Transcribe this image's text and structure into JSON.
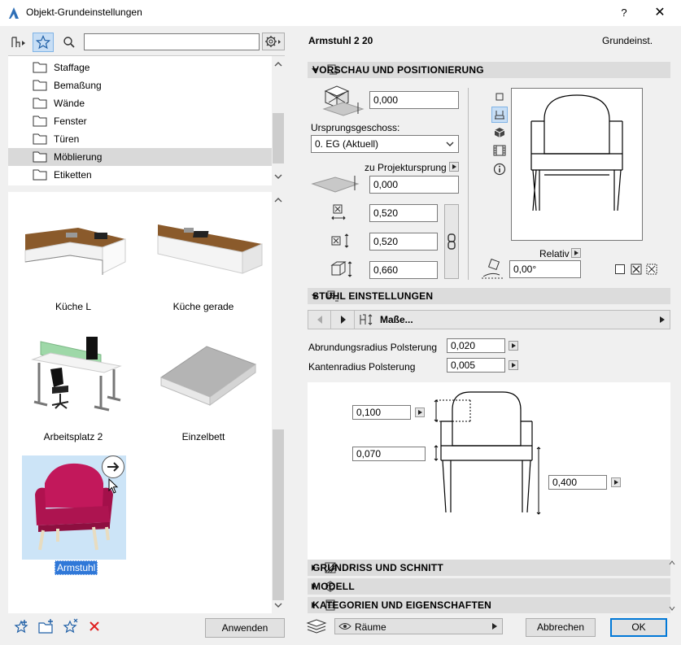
{
  "window": {
    "title": "Objekt-Grundeinstellungen",
    "help": "?",
    "close": "✕"
  },
  "library": {
    "search_placeholder": "",
    "folders": [
      {
        "label": "Staffage"
      },
      {
        "label": "Bemaßung"
      },
      {
        "label": "Wände"
      },
      {
        "label": "Fenster"
      },
      {
        "label": "Türen"
      },
      {
        "label": "Möblierung"
      },
      {
        "label": "Etiketten"
      }
    ],
    "thumbnails": [
      {
        "label": "Küche L"
      },
      {
        "label": "Küche gerade"
      },
      {
        "label": "Arbeitsplatz 2"
      },
      {
        "label": "Einzelbett"
      },
      {
        "label": "Armstuhl"
      }
    ],
    "apply_button": "Anwenden"
  },
  "object": {
    "name": "Armstuhl 2 20",
    "mode": "Grundeinst."
  },
  "preview_section": {
    "title": "VORSCHAU UND POSITIONIERUNG",
    "height_offset": "0,000",
    "ursprungsgeschoss_label": "Ursprungsgeschoss:",
    "ursprungsgeschoss_value": "0. EG (Aktuell)",
    "zu_projektursprung": "zu Projektursprung",
    "projekt_offset": "0,000",
    "width": "0,520",
    "depth": "0,520",
    "height": "0,660",
    "relativ": "Relativ",
    "angle": "0,00°"
  },
  "stuhl_section": {
    "title": "STUHL EINSTELLUNGEN",
    "nav_label": "Maße...",
    "abrundungsradius_label": "Abrundungsradius Polsterung",
    "abrundungsradius_value": "0,020",
    "kantenradius_label": "Kantenradius Polsterung",
    "kantenradius_value": "0,005",
    "dim_top": "0,100",
    "dim_mid": "0,070",
    "dim_side": "0,400"
  },
  "collapsed_sections": [
    {
      "title": "GRUNDRISS UND SCHNITT"
    },
    {
      "title": "MODELL"
    },
    {
      "title": "KATEGORIEN UND EIGENSCHAFTEN"
    }
  ],
  "footer": {
    "layer": "Räume",
    "cancel": "Abbrechen",
    "ok": "OK"
  }
}
